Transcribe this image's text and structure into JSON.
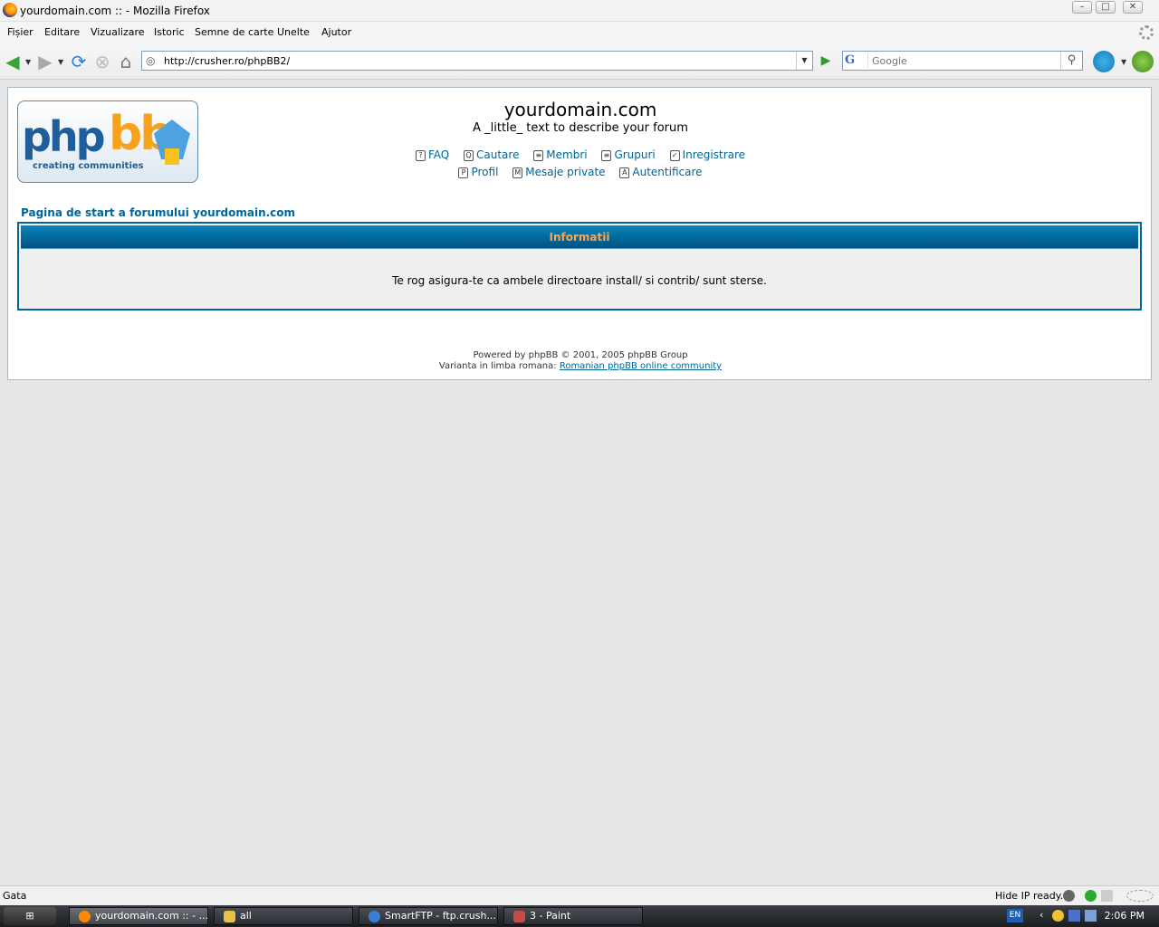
{
  "window": {
    "title": "yourdomain.com :: - Mozilla Firefox",
    "minimize": "–",
    "maximize": "□",
    "close": "✕"
  },
  "menu": [
    "Fișier",
    "Editare",
    "Vizualizare",
    "Istoric",
    "Semne de carte",
    "Unelte",
    "Ajutor"
  ],
  "toolbar": {
    "url": "http://crusher.ro/phpBB2/",
    "search_placeholder": "Google",
    "search_engine": "G"
  },
  "logo": {
    "php": "php",
    "bb": "bb",
    "tagline": "creating communities"
  },
  "site": {
    "title": "yourdomain.com",
    "description": "A _little_ text to describe your forum"
  },
  "nav_row1": [
    {
      "icon": "?",
      "label": "FAQ"
    },
    {
      "icon": "Q",
      "label": "Cautare"
    },
    {
      "icon": "≡",
      "label": "Membri"
    },
    {
      "icon": "≡",
      "label": "Grupuri"
    },
    {
      "icon": "✓",
      "label": "Inregistrare"
    }
  ],
  "nav_row2": [
    {
      "icon": "P",
      "label": "Profil"
    },
    {
      "icon": "M",
      "label": "Mesaje private"
    },
    {
      "icon": "A",
      "label": "Autentificare"
    }
  ],
  "breadcrumb": "Pagina de start a forumului yourdomain.com",
  "info": {
    "header": "Informatii",
    "message": "Te rog asigura-te ca ambele directoare install/ si contrib/ sunt sterse."
  },
  "footer": {
    "powered": "Powered by phpBB © 2001, 2005 phpBB Group",
    "variant_prefix": "Varianta in limba romana:",
    "variant_link": "Romanian phpBB online community"
  },
  "status": {
    "text": "Gata",
    "right": "Hide IP ready.."
  },
  "taskbar": {
    "tasks": [
      "yourdomain.com :: - ...",
      "all",
      "SmartFTP - ftp.crush...",
      "3 - Paint"
    ],
    "lang": "EN",
    "clock": "2:06 PM"
  },
  "colors": {
    "link": "#006699",
    "header_bg": "#006699",
    "header_text": "#ffa34f"
  }
}
